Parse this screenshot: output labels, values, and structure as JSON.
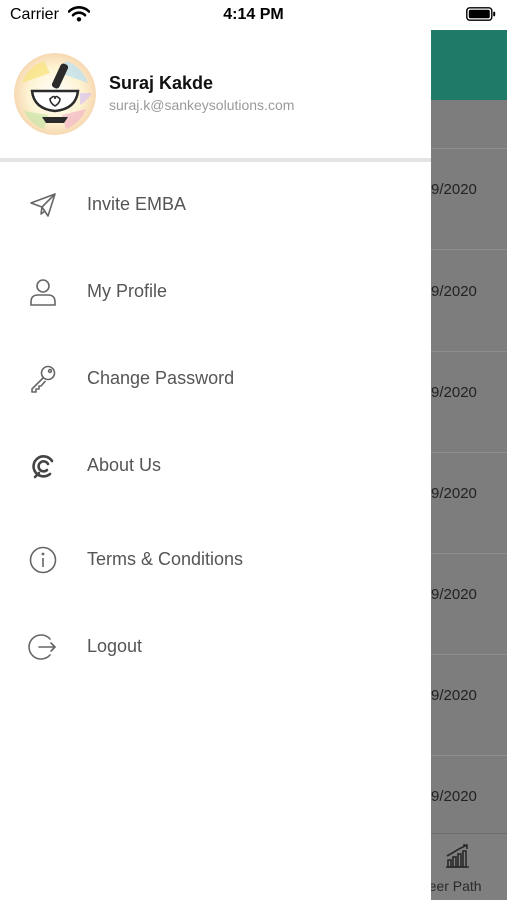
{
  "status_bar": {
    "carrier": "Carrier",
    "time": "4:14 PM"
  },
  "drawer": {
    "user": {
      "name": "Suraj Kakde",
      "email": "suraj.k@sankeysolutions.com"
    },
    "menu": [
      {
        "label": "Invite EMBA",
        "icon": "send-icon"
      },
      {
        "label": "My Profile",
        "icon": "user-icon"
      },
      {
        "label": "Change Password",
        "icon": "key-icon"
      },
      {
        "label": "About Us",
        "icon": "about-logo-icon"
      },
      {
        "label": "Terms & Conditions",
        "icon": "info-icon"
      },
      {
        "label": "Logout",
        "icon": "logout-icon"
      }
    ]
  },
  "background": {
    "dates": [
      "9/2020",
      "9/2020",
      "9/2020",
      "9/2020",
      "9/2020",
      "9/2020",
      "9/2020"
    ],
    "tab_label": "reer Path"
  },
  "colors": {
    "header_teal": "#1f7a68",
    "overlay": "#7d7d7d"
  }
}
